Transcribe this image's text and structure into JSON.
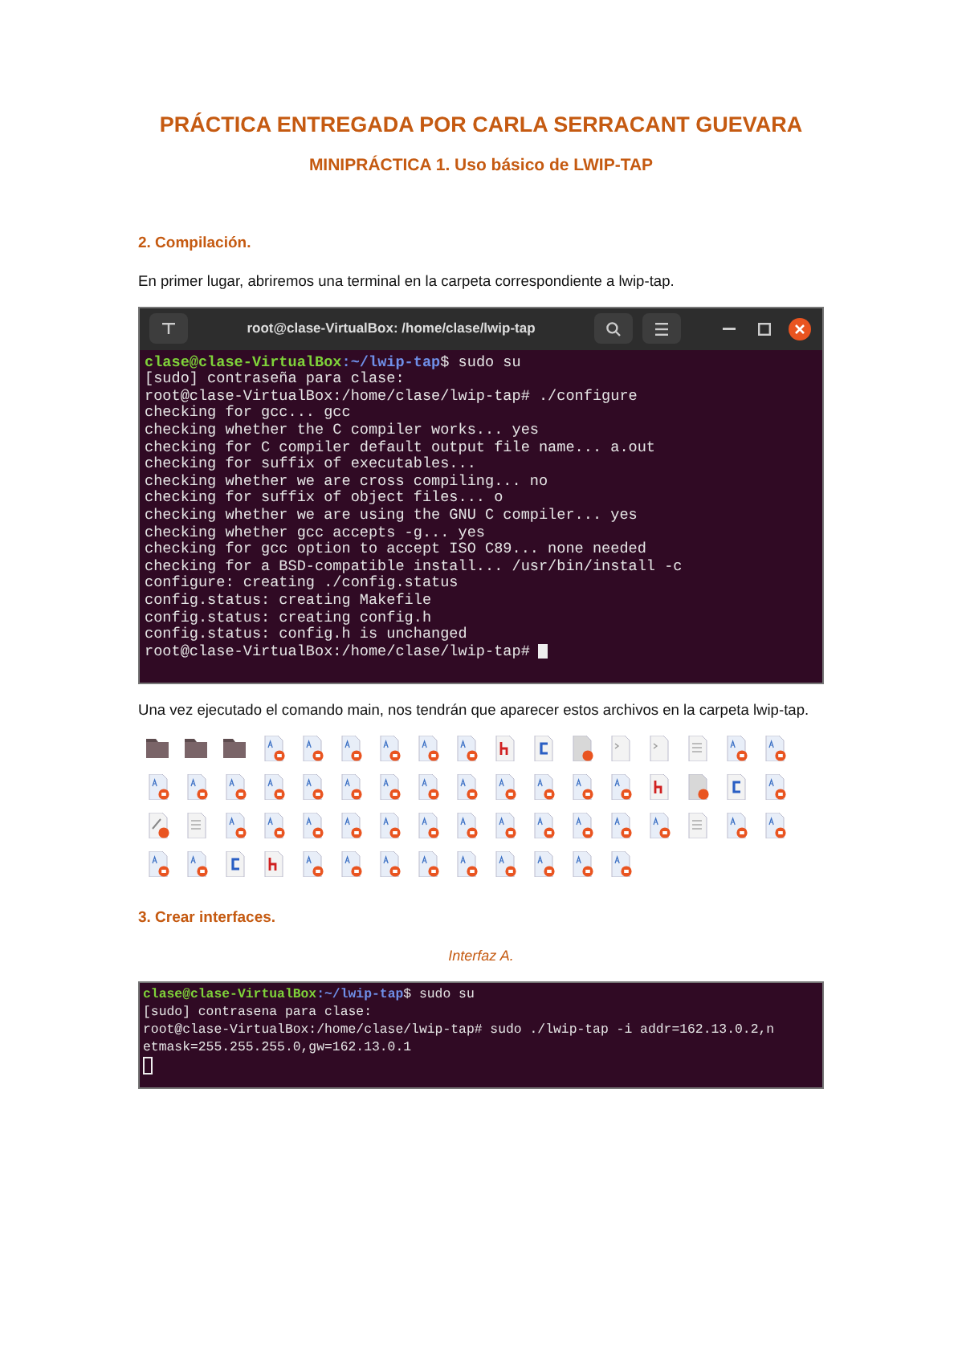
{
  "title": "PRÁCTICA ENTREGADA POR CARLA SERRACANT GUEVARA",
  "subtitle": "MINIPRÁCTICA 1. Uso básico de LWIP-TAP",
  "sections": [
    {
      "heading": "2. Compilación.",
      "paragraph": "En primer lugar, abriremos una terminal en la carpeta correspondiente a lwip-tap.",
      "terminal": {
        "title": "root@clase-VirtualBox: /home/clase/lwip-tap",
        "lines": [
          {
            "kind": "prompt",
            "user": "clase@clase-VirtualBox",
            "path": ":~/lwip-tap",
            "cmd": "$ sudo su"
          },
          {
            "kind": "output",
            "text": "[sudo] contraseña para clase:"
          },
          {
            "kind": "output",
            "text": "root@clase-VirtualBox:/home/clase/lwip-tap# ./configure"
          },
          {
            "kind": "output",
            "text": "checking for gcc... gcc"
          },
          {
            "kind": "output",
            "text": "checking whether the C compiler works... yes"
          },
          {
            "kind": "output",
            "text": "checking for C compiler default output file name... a.out"
          },
          {
            "kind": "output",
            "text": "checking for suffix of executables..."
          },
          {
            "kind": "output",
            "text": "checking whether we are cross compiling... no"
          },
          {
            "kind": "output",
            "text": "checking for suffix of object files... o"
          },
          {
            "kind": "output",
            "text": "checking whether we are using the GNU C compiler... yes"
          },
          {
            "kind": "output",
            "text": "checking whether gcc accepts -g... yes"
          },
          {
            "kind": "output",
            "text": "checking for gcc option to accept ISO C89... none needed"
          },
          {
            "kind": "output",
            "text": "checking for a BSD-compatible install... /usr/bin/install -c"
          },
          {
            "kind": "output",
            "text": "configure: creating ./config.status"
          },
          {
            "kind": "output",
            "text": "config.status: creating Makefile"
          },
          {
            "kind": "output",
            "text": "config.status: creating config.h"
          },
          {
            "kind": "output",
            "text": "config.status: config.h is unchanged"
          },
          {
            "kind": "cursor",
            "text": "root@clase-VirtualBox:/home/clase/lwip-tap# "
          }
        ]
      },
      "paragraph_2": "Una vez ejecutado el comando main, nos tendrán que aparecer estos archivos en la carpeta lwip-tap.",
      "files": [
        [
          {
            "kind": "folder"
          },
          {
            "kind": "folder"
          },
          {
            "kind": "folder"
          },
          {
            "kind": "source"
          },
          {
            "kind": "source"
          },
          {
            "kind": "source"
          },
          {
            "kind": "source"
          },
          {
            "kind": "source"
          },
          {
            "kind": "source"
          },
          {
            "kind": "header"
          },
          {
            "kind": "c"
          },
          {
            "kind": "image"
          },
          {
            "kind": "plain"
          },
          {
            "kind": "plain"
          },
          {
            "kind": "text"
          },
          {
            "kind": "source"
          },
          {
            "kind": "source"
          }
        ],
        [
          {
            "kind": "source"
          },
          {
            "kind": "source"
          },
          {
            "kind": "source"
          },
          {
            "kind": "source"
          },
          {
            "kind": "source"
          },
          {
            "kind": "source"
          },
          {
            "kind": "source"
          },
          {
            "kind": "source"
          },
          {
            "kind": "source"
          },
          {
            "kind": "source"
          },
          {
            "kind": "source"
          },
          {
            "kind": "source"
          },
          {
            "kind": "source"
          },
          {
            "kind": "header"
          },
          {
            "kind": "image"
          },
          {
            "kind": "c"
          },
          {
            "kind": "source"
          }
        ],
        [
          {
            "kind": "script"
          },
          {
            "kind": "text"
          },
          {
            "kind": "source"
          },
          {
            "kind": "source"
          },
          {
            "kind": "source"
          },
          {
            "kind": "source"
          },
          {
            "kind": "source"
          },
          {
            "kind": "source"
          },
          {
            "kind": "source"
          },
          {
            "kind": "source"
          },
          {
            "kind": "source"
          },
          {
            "kind": "source"
          },
          {
            "kind": "source"
          },
          {
            "kind": "source"
          },
          {
            "kind": "text"
          },
          {
            "kind": "source"
          },
          {
            "kind": "source"
          }
        ],
        [
          {
            "kind": "source"
          },
          {
            "kind": "source"
          },
          {
            "kind": "c"
          },
          {
            "kind": "header"
          },
          {
            "kind": "source"
          },
          {
            "kind": "source"
          },
          {
            "kind": "source"
          },
          {
            "kind": "source"
          },
          {
            "kind": "source"
          },
          {
            "kind": "source"
          },
          {
            "kind": "source"
          },
          {
            "kind": "source"
          },
          {
            "kind": "source"
          }
        ]
      ]
    },
    {
      "heading": "3. Crear interfaces.",
      "caption": "Interfaz A.",
      "terminal": {
        "lines": [
          {
            "kind": "prompt",
            "user": "clase@clase-VirtualBox",
            "path": ":~/lwip-tap",
            "cmd": "$ sudo su"
          },
          {
            "kind": "output",
            "text": "[sudo] contrasena para clase:"
          },
          {
            "kind": "output",
            "text": "root@clase-VirtualBox:/home/clase/lwip-tap# sudo ./lwip-tap -i addr=162.13.0.2,n"
          },
          {
            "kind": "output",
            "text": "etmask=255.255.255.0,gw=162.13.0.1"
          },
          {
            "kind": "cursor"
          }
        ]
      }
    }
  ]
}
